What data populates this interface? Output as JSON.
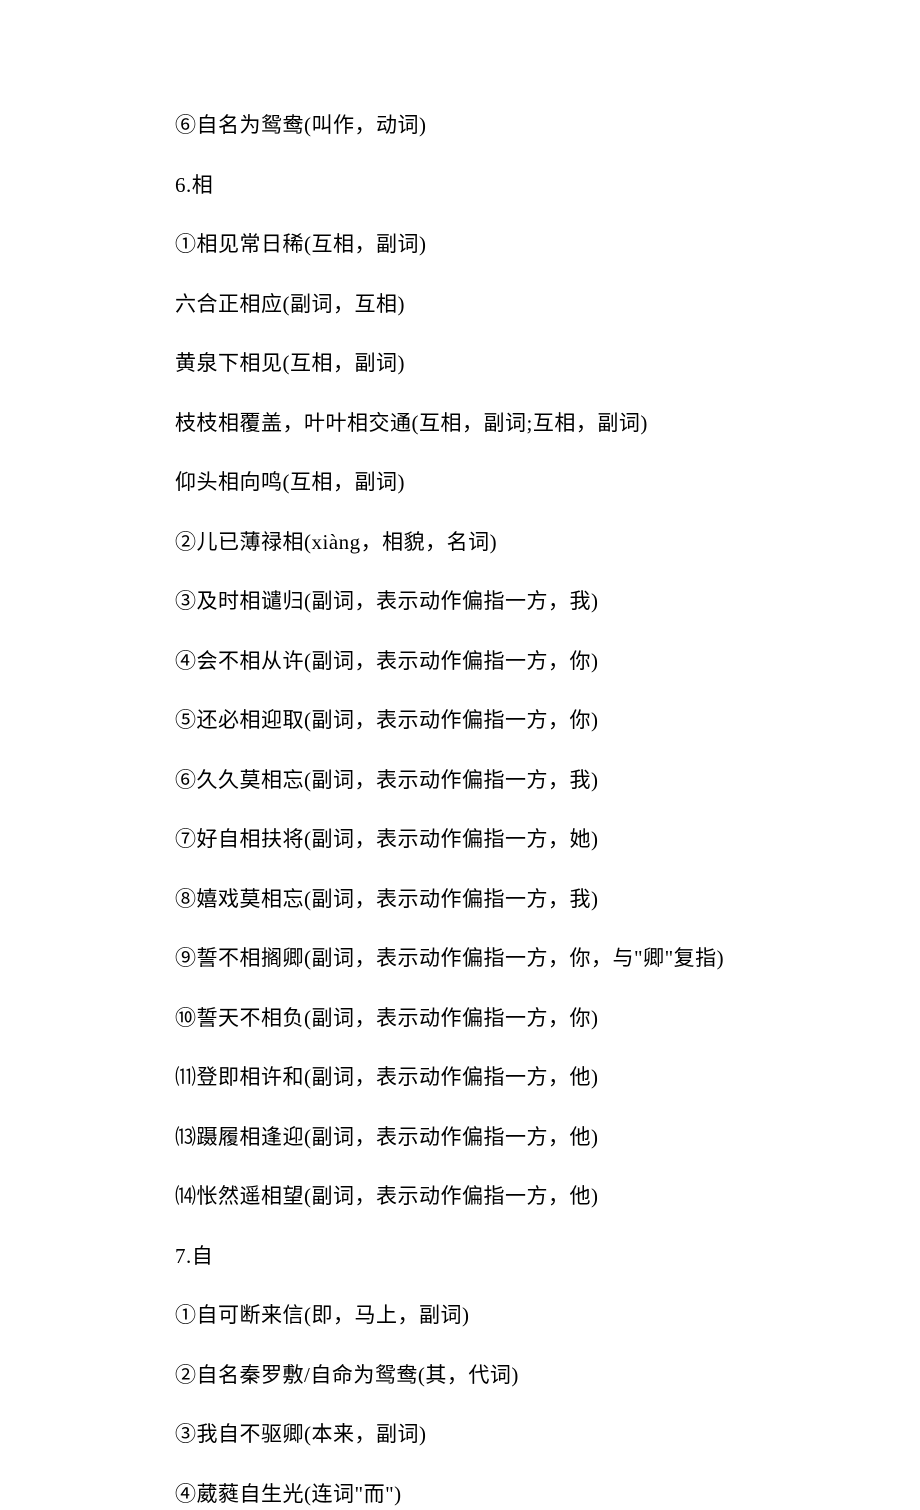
{
  "lines": [
    "⑥自名为鸳鸯(叫作，动词)",
    "6.相",
    "①相见常日稀(互相，副词)",
    "六合正相应(副词，互相)",
    "黄泉下相见(互相，副词)",
    "枝枝相覆盖，叶叶相交通(互相，副词;互相，副词)",
    "仰头相向鸣(互相，副词)",
    "②儿已薄禄相(xiàng，相貌，名词)",
    "③及时相谴归(副词，表示动作偏指一方，我)",
    "④会不相从许(副词，表示动作偏指一方，你)",
    "⑤还必相迎取(副词，表示动作偏指一方，你)",
    "⑥久久莫相忘(副词，表示动作偏指一方，我)",
    "⑦好自相扶将(副词，表示动作偏指一方，她)",
    "⑧嬉戏莫相忘(副词，表示动作偏指一方，我)",
    "⑨誓不相搁卿(副词，表示动作偏指一方，你，与\"卿\"复指)",
    "⑩誓天不相负(副词，表示动作偏指一方，你)",
    "⑾登即相许和(副词，表示动作偏指一方，他)",
    "⒀蹑履相逢迎(副词，表示动作偏指一方，他)",
    "⒁怅然遥相望(副词，表示动作偏指一方，他)",
    "7.自",
    "①自可断来信(即，马上，副词)",
    "②自名秦罗敷/自命为鸳鸯(其，代词)",
    "③我自不驱卿(本来，副词)",
    "④葳蕤自生光(连词\"而\")"
  ]
}
